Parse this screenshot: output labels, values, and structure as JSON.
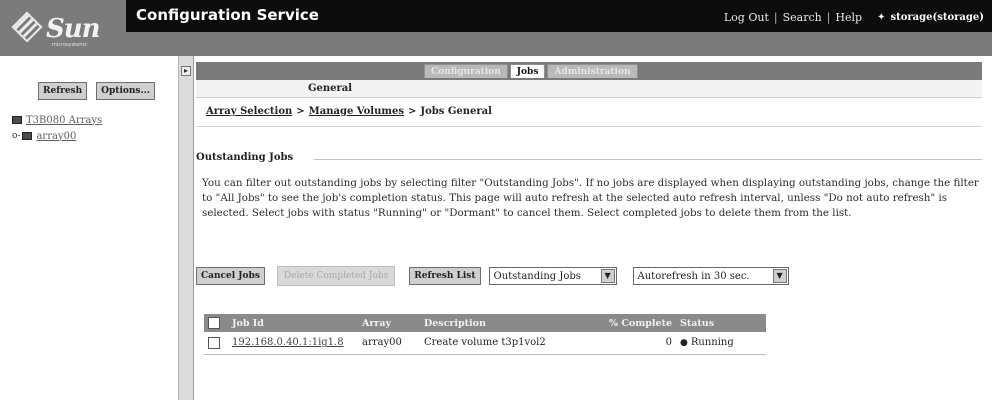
{
  "header": {
    "logo_text": "Sun",
    "logo_sub": "microsystems",
    "title": "Configuration Service",
    "links": [
      "Log Out",
      "Search",
      "Help"
    ],
    "user": "storage(storage)",
    "colors": {
      "masthead_top": "#0c0c0c",
      "masthead": "#7b7b7b"
    }
  },
  "left": {
    "refresh_label": "Refresh",
    "options_label": "Options...",
    "tree": [
      {
        "label": "T3B080 Arrays",
        "icon": "array-group-icon"
      },
      {
        "label": "array00",
        "icon": "array-icon",
        "expand": "o-"
      }
    ]
  },
  "tabs": [
    "Configuration",
    "Jobs",
    "Administration"
  ],
  "active_tab": "Jobs",
  "subtab": "General",
  "breadcrumb": [
    "Array Selection",
    "Manage Volumes",
    "Jobs General"
  ],
  "section": {
    "title": "Outstanding Jobs",
    "description": "You can filter out outstanding jobs by selecting filter \"Outstanding Jobs\". If no jobs are displayed when displaying outstanding jobs, change the filter to \"All Jobs\" to see the job's completion status. This page will auto refresh at the selected auto refresh interval, unless \"Do not auto refresh\" is selected. Select jobs with status \"Running\" or \"Dormant\" to cancel them. Select completed jobs to delete them from the list."
  },
  "controls": {
    "cancel_label": "Cancel Jobs",
    "delete_label": "Delete Completed Jobs",
    "refresh_label": "Refresh List",
    "filter_value": "Outstanding Jobs",
    "autorefresh_value": "Autorefresh in 30 sec."
  },
  "table": {
    "headers": [
      "",
      "Job Id",
      "Array",
      "Description",
      "% Complete",
      "Status"
    ],
    "rows": [
      {
        "job_id": "192.168.0.40.1:1ig1.8",
        "array": "array00",
        "description": "Create volume t3p1vol2",
        "complete": "0",
        "status": "Running"
      }
    ]
  }
}
